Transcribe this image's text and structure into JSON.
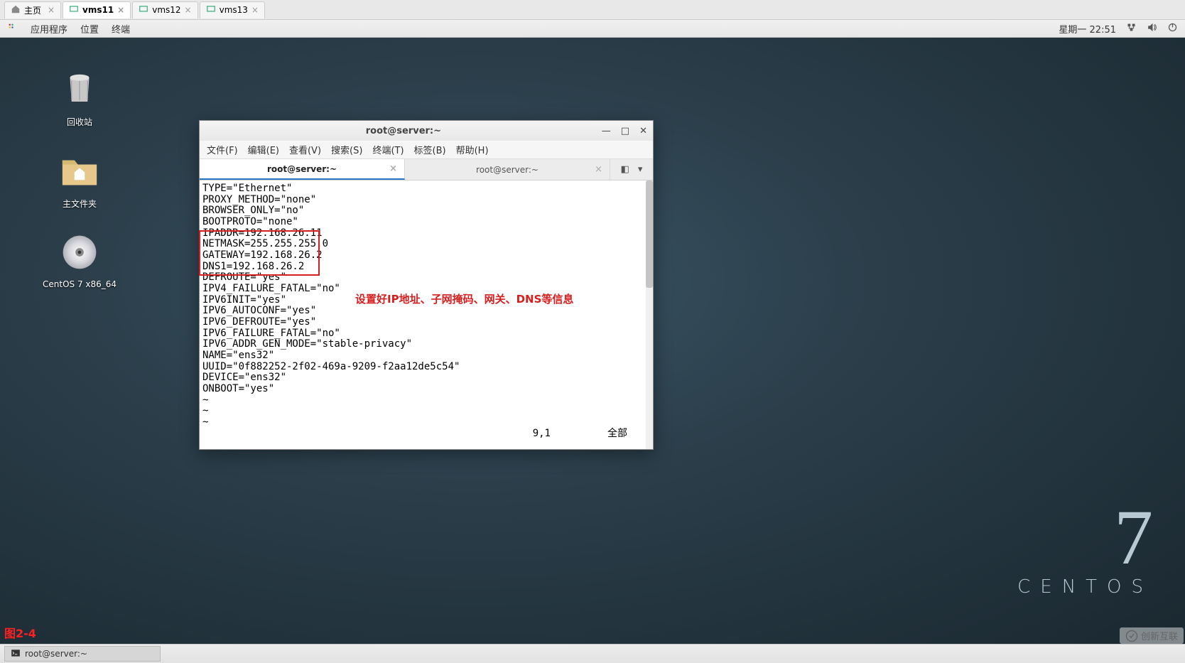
{
  "browser_tabs": [
    {
      "label": "主页",
      "active": false
    },
    {
      "label": "vms11",
      "active": true
    },
    {
      "label": "vms12",
      "active": false
    },
    {
      "label": "vms13",
      "active": false
    }
  ],
  "gnome_panel": {
    "app_menu": "应用程序",
    "places": "位置",
    "terminal": "终端",
    "clock": "星期一 22:51"
  },
  "desktop_icons": {
    "trash": "回收站",
    "home": "主文件夹",
    "media": "CentOS 7 x86_64"
  },
  "centos": {
    "seven": "7",
    "word": "CENTOS"
  },
  "watermark": "创新互联",
  "figure_label": "图2-4",
  "terminal": {
    "title": "root@server:~",
    "menu": [
      "文件(F)",
      "编辑(E)",
      "查看(V)",
      "搜索(S)",
      "终端(T)",
      "标签(B)",
      "帮助(H)"
    ],
    "tabs": [
      {
        "label": "root@server:~",
        "active": true
      },
      {
        "label": "root@server:~",
        "active": false
      }
    ],
    "lines": [
      "TYPE=\"Ethernet\"",
      "PROXY_METHOD=\"none\"",
      "BROWSER_ONLY=\"no\"",
      "BOOTPROTO=\"none\"",
      "IPADDR=192.168.26.11",
      "NETMASK=255.255.255.0",
      "GATEWAY=192.168.26.2",
      "DNS1=192.168.26.2",
      "DEFROUTE=\"yes\"",
      "IPV4_FAILURE_FATAL=\"no\"",
      "IPV6INIT=\"yes\"",
      "IPV6_AUTOCONF=\"yes\"",
      "IPV6_DEFROUTE=\"yes\"",
      "IPV6_FAILURE_FATAL=\"no\"",
      "IPV6_ADDR_GEN_MODE=\"stable-privacy\"",
      "NAME=\"ens32\"",
      "UUID=\"0f882252-2f02-469a-9209-f2aa12de5c54\"",
      "DEVICE=\"ens32\"",
      "ONBOOT=\"yes\"",
      "~",
      "~",
      "~"
    ],
    "status_pos": "9,1",
    "status_right": "全部",
    "annotation": "设置好IP地址、子网掩码、网关、DNS等信息"
  },
  "taskbar": {
    "button": "root@server:~"
  }
}
